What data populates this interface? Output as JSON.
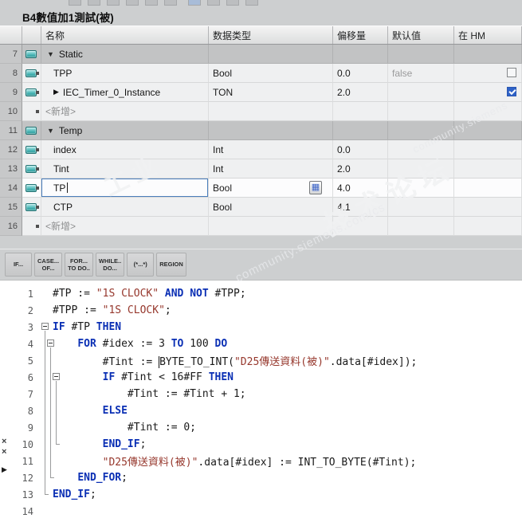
{
  "window": {
    "title": "B4數值加1測試(被)"
  },
  "icons": {
    "expanded": "▼",
    "collapsed": "▶",
    "picker": "▦",
    "close": "×",
    "play": "▶"
  },
  "colors": {
    "keyword": "#0a2fb4",
    "string": "#96372c",
    "plain": "#1a1a1a",
    "checkbox_checked": "#2e62c8",
    "edit_border": "#4a7ebb",
    "tag_icon": "#49b4b4"
  },
  "table": {
    "columns": [
      "名称",
      "数据类型",
      "偏移量",
      "默认值",
      "在 HM"
    ],
    "rows": [
      {
        "num": "7",
        "kind": "group",
        "name": "Static"
      },
      {
        "num": "8",
        "kind": "var",
        "name": "TPP",
        "type": "Bool",
        "offset": "0.0",
        "default": "false",
        "hmi": "unchecked"
      },
      {
        "num": "9",
        "kind": "var",
        "expandable": true,
        "name": "IEC_Timer_0_Instance",
        "type": "TON",
        "offset": "2.0",
        "hmi": "checked"
      },
      {
        "num": "10",
        "kind": "add",
        "name": "<新增>"
      },
      {
        "num": "11",
        "kind": "group",
        "name": "Temp"
      },
      {
        "num": "12",
        "kind": "var",
        "name": "index",
        "type": "Int",
        "offset": "0.0"
      },
      {
        "num": "13",
        "kind": "var",
        "name": "Tint",
        "type": "Int",
        "offset": "2.0"
      },
      {
        "num": "14",
        "kind": "var",
        "selected": true,
        "name": "TP",
        "type": "Bool",
        "offset": "4.0"
      },
      {
        "num": "15",
        "kind": "var",
        "name": "CTP",
        "type": "Bool",
        "offset": "4.1"
      },
      {
        "num": "16",
        "kind": "add",
        "name": "<新增>"
      }
    ]
  },
  "editor": {
    "toolbar": [
      {
        "label": "IF..."
      },
      {
        "label": "CASE...\nOF..."
      },
      {
        "label": "FOR...\nTO DO.."
      },
      {
        "label": "WHILE..\nDO..."
      },
      {
        "label": "(*...*)"
      },
      {
        "label": "REGION"
      }
    ],
    "lines": [
      {
        "num": 1,
        "segs": [
          [
            "p",
            "#TP := "
          ],
          [
            "s",
            "\"1S CLOCK\""
          ],
          [
            "p",
            " "
          ],
          [
            "k",
            "AND"
          ],
          [
            "p",
            " "
          ],
          [
            "k",
            "NOT"
          ],
          [
            "p",
            " #TPP;"
          ]
        ]
      },
      {
        "num": 2,
        "segs": [
          [
            "p",
            "#TPP := "
          ],
          [
            "s",
            "\"1S CLOCK\""
          ],
          [
            "p",
            ";"
          ]
        ]
      },
      {
        "num": 3,
        "fold": 0,
        "segs": [
          [
            "k",
            "IF"
          ],
          [
            "p",
            " #TP "
          ],
          [
            "k",
            "THEN"
          ]
        ]
      },
      {
        "num": 4,
        "fold": 1,
        "segs": [
          [
            "p",
            "    "
          ],
          [
            "k",
            "FOR"
          ],
          [
            "p",
            " #idex := 3 "
          ],
          [
            "k",
            "TO"
          ],
          [
            "p",
            " 100 "
          ],
          [
            "k",
            "DO"
          ]
        ]
      },
      {
        "num": 5,
        "segs": [
          [
            "p",
            "        #Tint := "
          ],
          [
            "cur",
            ""
          ],
          [
            "p",
            "BYTE_TO_INT("
          ],
          [
            "s",
            "\"D25傳送資料(被)\""
          ],
          [
            "p",
            ".data[#idex]);"
          ]
        ]
      },
      {
        "num": 6,
        "fold": 2,
        "segs": [
          [
            "p",
            "        "
          ],
          [
            "k",
            "IF"
          ],
          [
            "p",
            " #Tint < 16#FF "
          ],
          [
            "k",
            "THEN"
          ]
        ]
      },
      {
        "num": 7,
        "segs": [
          [
            "p",
            "            #Tint := #Tint + 1;"
          ]
        ]
      },
      {
        "num": 8,
        "segs": [
          [
            "p",
            "        "
          ],
          [
            "k",
            "ELSE"
          ]
        ]
      },
      {
        "num": 9,
        "segs": [
          [
            "p",
            "            #Tint := 0;"
          ]
        ]
      },
      {
        "num": 10,
        "segs": [
          [
            "p",
            "        "
          ],
          [
            "k",
            "END_IF"
          ],
          [
            "p",
            ";"
          ]
        ]
      },
      {
        "num": 11,
        "segs": [
          [
            "p",
            "        "
          ],
          [
            "s",
            "\"D25傳送資料(被)\""
          ],
          [
            "p",
            ".data[#idex] := INT_TO_BYTE(#Tint);"
          ]
        ]
      },
      {
        "num": 12,
        "segs": [
          [
            "p",
            "    "
          ],
          [
            "k",
            "END_FOR"
          ],
          [
            "p",
            ";"
          ]
        ]
      },
      {
        "num": 13,
        "segs": [
          [
            "k",
            "END_IF"
          ],
          [
            "p",
            ";"
          ]
        ]
      },
      {
        "num": 14,
        "segs": []
      }
    ],
    "fold_guides": [
      {
        "from": 3,
        "to": 13,
        "col": 0
      },
      {
        "from": 4,
        "to": 12,
        "col": 1
      },
      {
        "from": 6,
        "to": 10,
        "col": 2
      }
    ]
  },
  "watermark": {
    "texts": [
      {
        "text": "工业",
        "size": 30
      },
      {
        "text": "技术论坛",
        "size": 36
      },
      {
        "text": "community.siemens.com/cs",
        "size": 15
      },
      {
        "text": "community.siemens",
        "size": 13
      }
    ]
  }
}
